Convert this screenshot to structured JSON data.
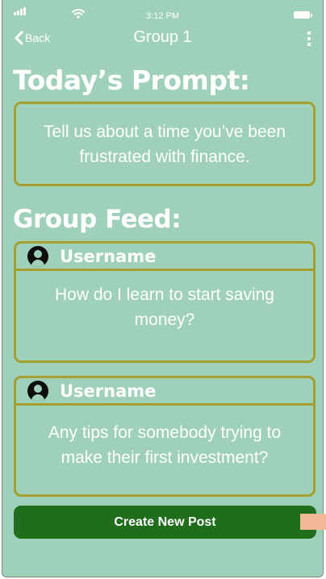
{
  "status_bar": {
    "time": "3:12 PM",
    "icons": [
      "signal-icon",
      "wifi-icon",
      "battery-icon"
    ]
  },
  "nav": {
    "back_label": "Back",
    "title": "Group 1",
    "menu_icon": "more-vertical-icon"
  },
  "prompt": {
    "heading": "Today’s Prompt:",
    "text": "Tell us about a time you’ve been frustrated with finance."
  },
  "feed": {
    "heading": "Group Feed:",
    "posts": [
      {
        "username": "Username",
        "text": "How do I learn to start saving money?"
      },
      {
        "username": "Username",
        "text": "Any tips for somebody trying to make their first investment?"
      }
    ]
  },
  "actions": {
    "create_post_label": "Create New Post"
  },
  "colors": {
    "background": "#9fd1ba",
    "card_border": "#a3a02f",
    "button": "#206e1c",
    "side_tab": "#f3b896",
    "text": "#ffffff"
  }
}
